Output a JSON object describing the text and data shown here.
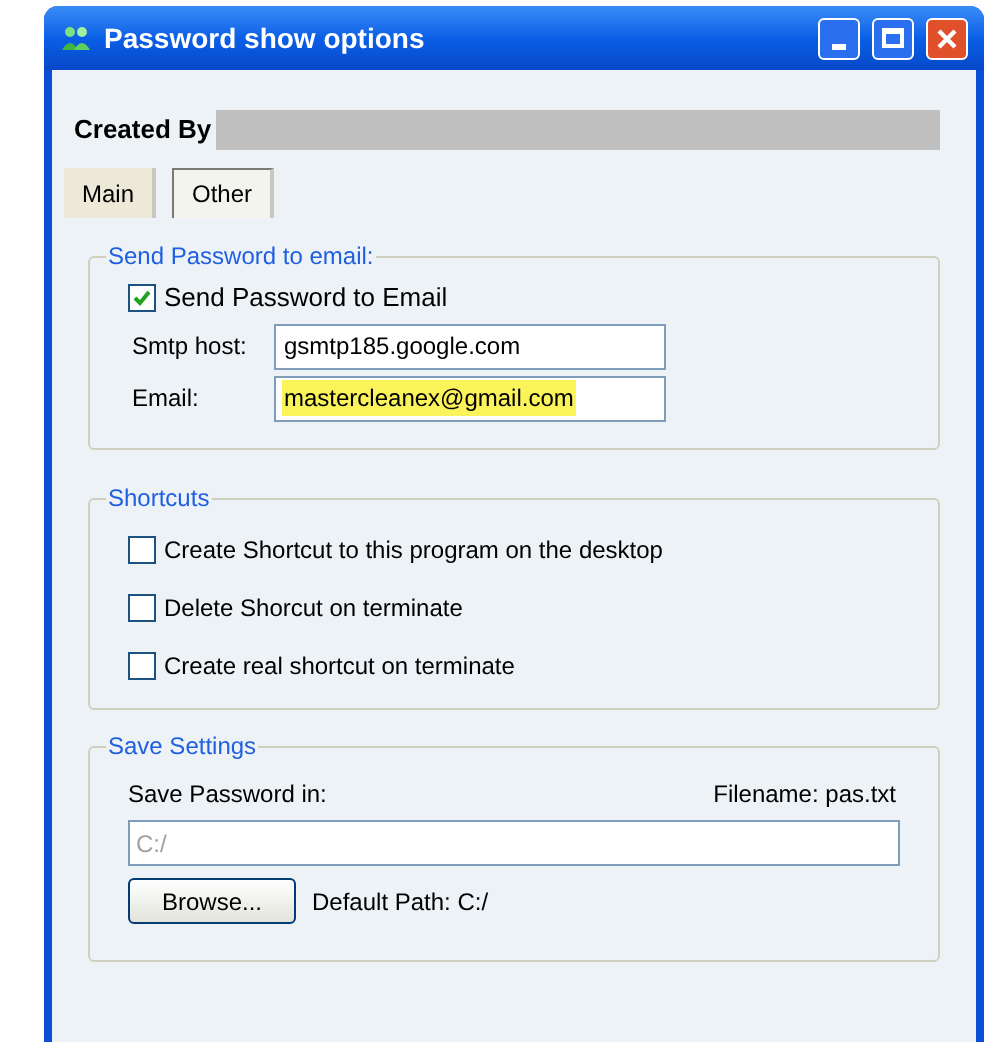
{
  "window": {
    "title": "Password show options"
  },
  "created_by": {
    "label": "Created By"
  },
  "tabs": [
    {
      "label": "Main",
      "selected": false
    },
    {
      "label": "Other",
      "selected": true
    }
  ],
  "send_group": {
    "title": "Send Password to email:",
    "send_checkbox": {
      "label": "Send Password to Email",
      "checked": true
    },
    "fields": [
      {
        "label": "Smtp host:",
        "value": "gsmtp185.google.com",
        "highlighted": false
      },
      {
        "label": "Email:",
        "value": "mastercleanex@gmail.com",
        "highlighted": true
      }
    ]
  },
  "shortcuts_group": {
    "title": "Shortcuts",
    "options": [
      {
        "label": "Create Shortcut to this program on the desktop",
        "checked": false
      },
      {
        "label": "Delete Shorcut on terminate",
        "checked": false
      },
      {
        "label": "Create real shortcut on terminate",
        "checked": false
      }
    ]
  },
  "save_group": {
    "title": "Save Settings",
    "label": "Save Password in:",
    "filename": "Filename: pas.txt",
    "path_field": {
      "value": "C:/",
      "disabled": true
    },
    "browse_button": "Browse...",
    "default_path": "Default Path: C:/"
  }
}
